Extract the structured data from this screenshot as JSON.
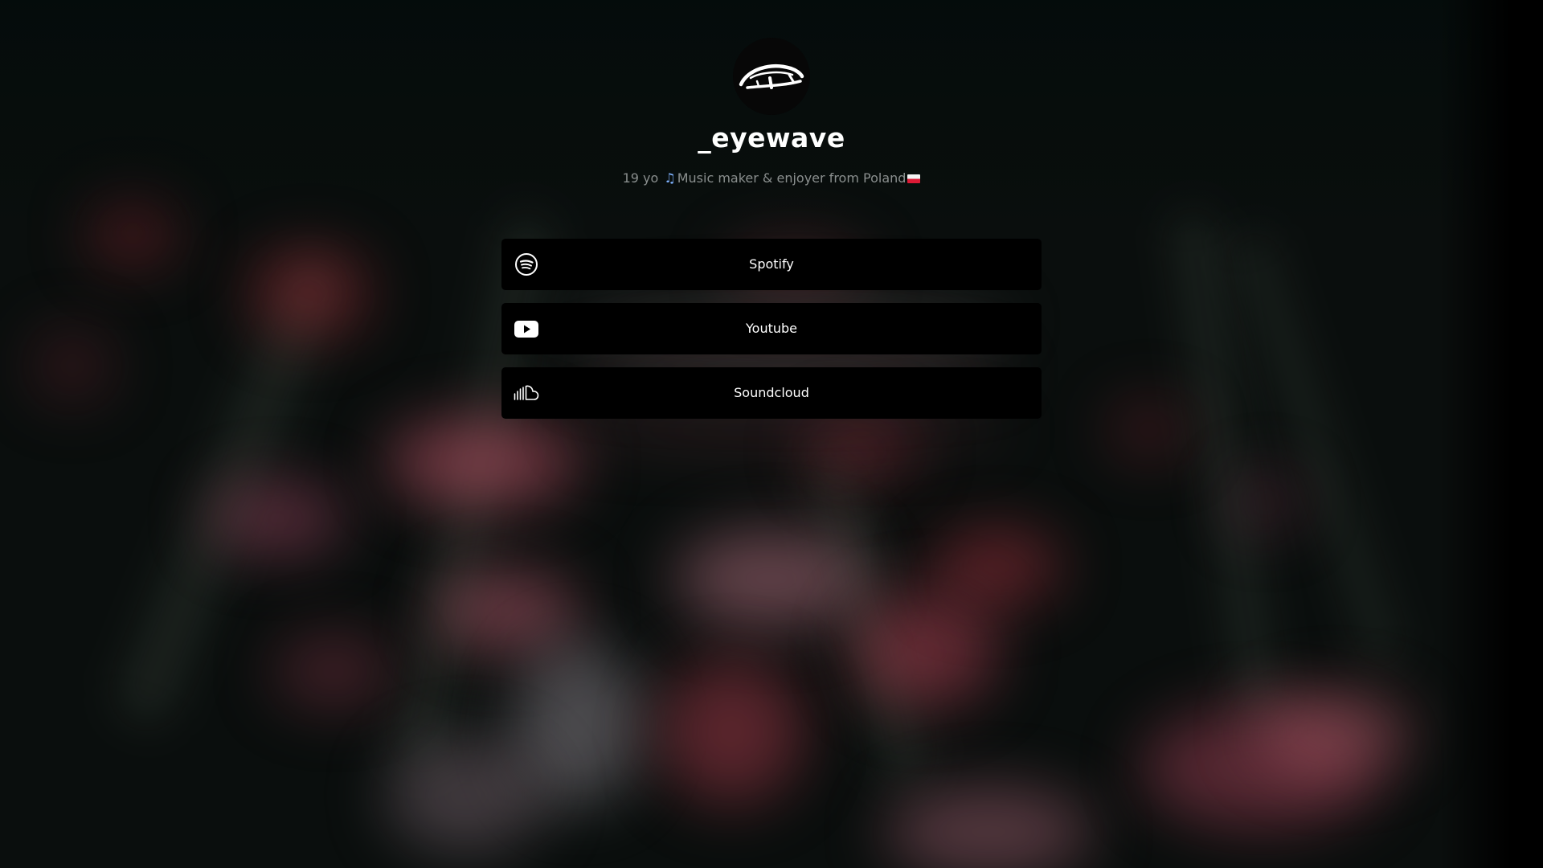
{
  "profile": {
    "avatar_icon": "eye-wave-logo-icon",
    "username": "_eyewave",
    "bio": {
      "prefix": "19 yo",
      "note_icon": "musical-notes-icon",
      "text": "Music maker & enjoyer from Poland",
      "flag_icon": "poland-flag-icon"
    }
  },
  "links": [
    {
      "label": "Spotify",
      "icon": "spotify-icon"
    },
    {
      "label": "Youtube",
      "icon": "youtube-icon"
    },
    {
      "label": "Soundcloud",
      "icon": "soundcloud-icon"
    }
  ],
  "colors": {
    "button_bg": "#000000",
    "text": "#ffffff",
    "bio_text": "#8a8f8e",
    "background": "#0a0e0d"
  }
}
